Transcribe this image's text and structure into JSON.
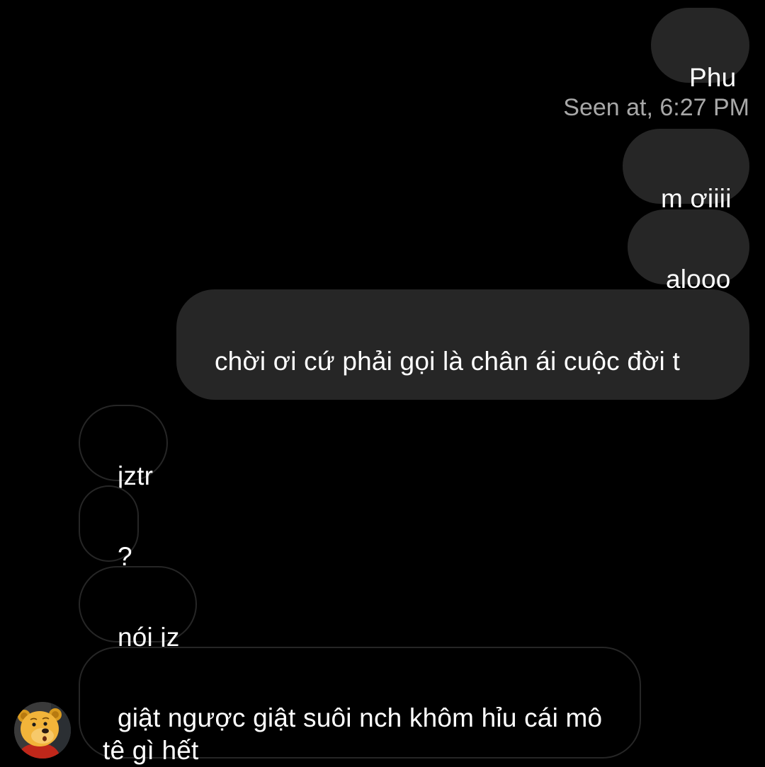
{
  "outgoing": [
    {
      "text": "Phu"
    },
    {
      "text": "m ơiiii"
    },
    {
      "text": "alooo"
    },
    {
      "text": "chời ơi cứ phải gọi là chân ái cuộc đời t"
    }
  ],
  "seen_status": "Seen at, 6:27 PM",
  "incoming": [
    {
      "text": "jztr"
    },
    {
      "text": "?"
    },
    {
      "text": "nói jz"
    },
    {
      "text": "giật ngược giật suôi nch khôm hỉu cái mô tê gì hết"
    }
  ],
  "colors": {
    "background": "#000000",
    "outgoing_bubble": "#262626",
    "incoming_border": "#262626",
    "text": "#ffffff",
    "seen_text": "#a8a8a8"
  },
  "avatar": {
    "icon": "winnie-the-pooh-avatar-icon"
  }
}
